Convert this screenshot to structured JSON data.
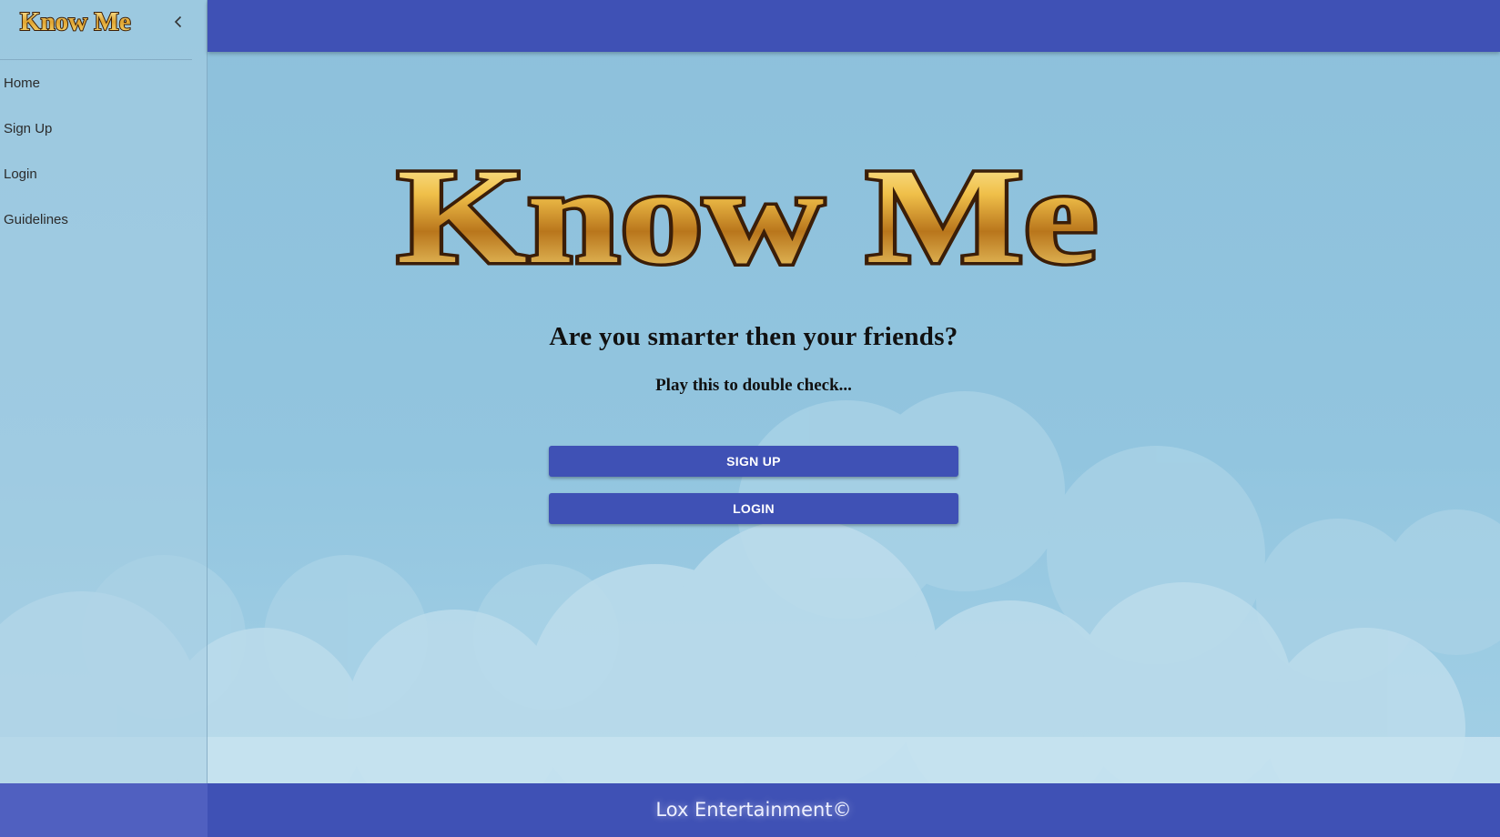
{
  "app": {
    "brand": "Know Me"
  },
  "sidebar": {
    "logo_text": "Know Me",
    "collapse_icon": "chevron-left-icon",
    "items": [
      {
        "label": "Home"
      },
      {
        "label": "Sign Up"
      },
      {
        "label": "Login"
      },
      {
        "label": "Guidelines"
      }
    ]
  },
  "hero": {
    "logo_text": "Know Me",
    "headline": "Are you smarter then your friends?",
    "subline": "Play this to double check..."
  },
  "actions": {
    "signup_label": "SIGN UP",
    "login_label": "LOGIN"
  },
  "footer": {
    "text": "Lox Entertainment©"
  },
  "colors": {
    "primary": "#3f51b5",
    "sky": "#8fc1dc",
    "gold": "#f2c24a",
    "outline": "#3b1e08"
  }
}
